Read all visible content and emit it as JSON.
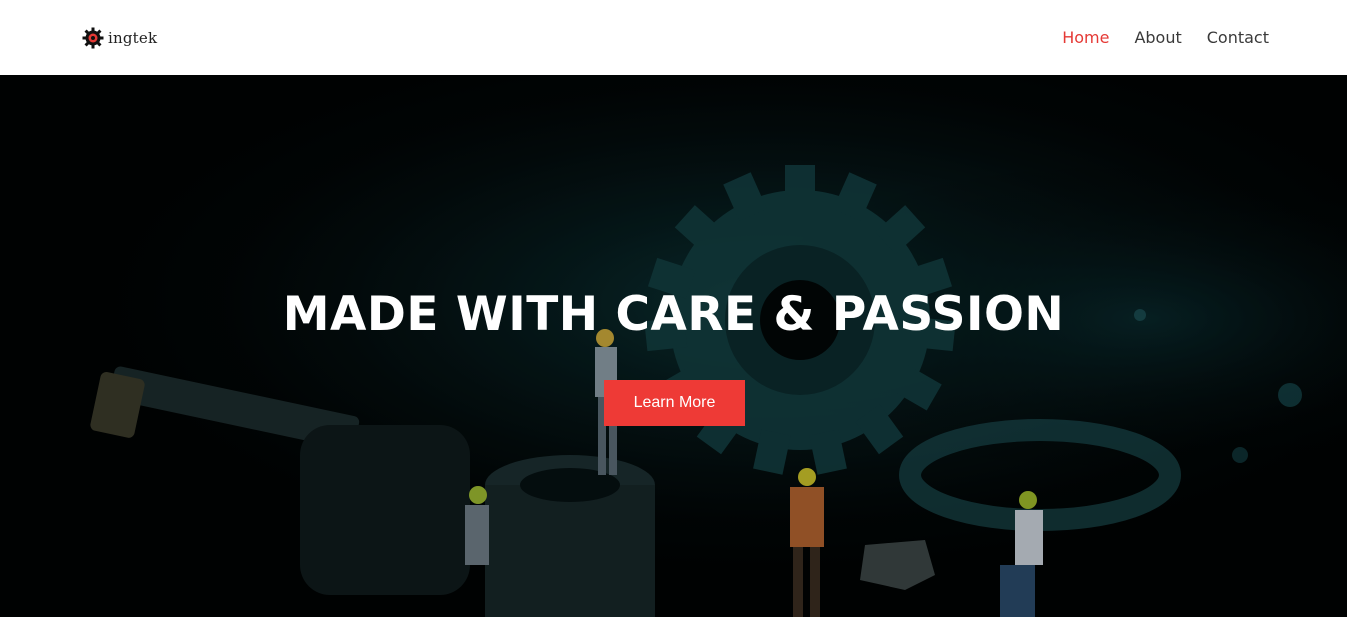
{
  "brand": {
    "name": "ingtek",
    "logo_icon": "gear-logo-icon",
    "accent_color": "#e53935"
  },
  "nav": {
    "items": [
      {
        "label": "Home",
        "active": true
      },
      {
        "label": "About",
        "active": false
      },
      {
        "label": "Contact",
        "active": false
      }
    ]
  },
  "hero": {
    "title": "MADE WITH CARE & PASSION",
    "button_label": "Learn More",
    "button_color": "#ee3a36",
    "background": "dark teal gears with miniature workers"
  }
}
